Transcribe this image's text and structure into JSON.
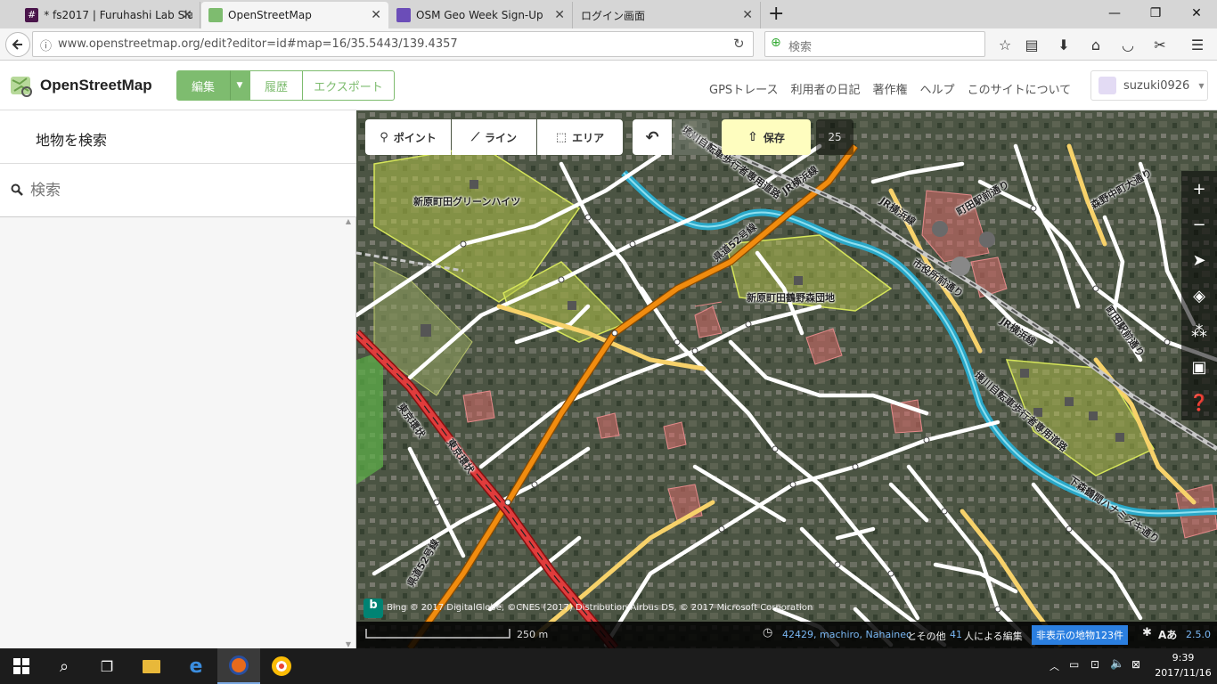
{
  "browser": {
    "tabs": [
      {
        "label": "* fs2017 | Furuhashi Lab Slac",
        "active": false
      },
      {
        "label": "OpenStreetMap",
        "active": true
      },
      {
        "label": "OSM Geo Week Sign-Up",
        "active": false
      },
      {
        "label": "ログイン画面",
        "active": false
      }
    ],
    "new_tab": "+",
    "url": "www.openstreetmap.org/edit?editor=id#map=16/35.5443/139.4357",
    "search_placeholder": "検索"
  },
  "osm": {
    "brand": "OpenStreetMap",
    "edit_label": "編集",
    "history_label": "履歴",
    "export_label": "エクスポート",
    "links": [
      "GPSトレース",
      "利用者の日記",
      "著作権",
      "ヘルプ",
      "このサイトについて"
    ],
    "username": "suzuki0926"
  },
  "sidebar": {
    "title": "地物を検索",
    "search_placeholder": "検索"
  },
  "editor": {
    "point_label": "ポイント",
    "line_label": "ライン",
    "area_label": "エリア",
    "save_label": "保存",
    "save_count": "25",
    "map_labels": [
      "新原町田グリーンハイツ",
      "新原町田鶴野森団地",
      "東京環状",
      "東京環状",
      "町田駅前通り",
      "森野中町大通り",
      "市役所前通り",
      "JR横浜線",
      "JR横浜線",
      "町田駅前通り",
      "境川自転車歩行者専用道路",
      "下森鶴間ハナミズキ通り",
      "県道52号線",
      "県道52号線",
      "境川自転車歩行者専用道路",
      "JR横浜線"
    ],
    "imagery_credit": "Bing © 2017 DigitalGlobe, ©CNES (2017) Distribution Airbus DS, © 2017 Microsoft Corporation",
    "scale": "250 m",
    "contributors_names": "42429, machiro, Nahainec",
    "contributors_mid": "とその他",
    "contributors_count": "41",
    "contributors_suffix": "人による編集",
    "hidden_features": "非表示の地物123件",
    "version": "2.5.0"
  },
  "taskbar": {
    "time": "9:39",
    "date": "2017/11/16"
  },
  "colors": {
    "osm_green": "#7ebc6f",
    "primary_road": "#f18c0f",
    "motorway": "#e03c3c",
    "save_bg": "#fefdbf"
  }
}
